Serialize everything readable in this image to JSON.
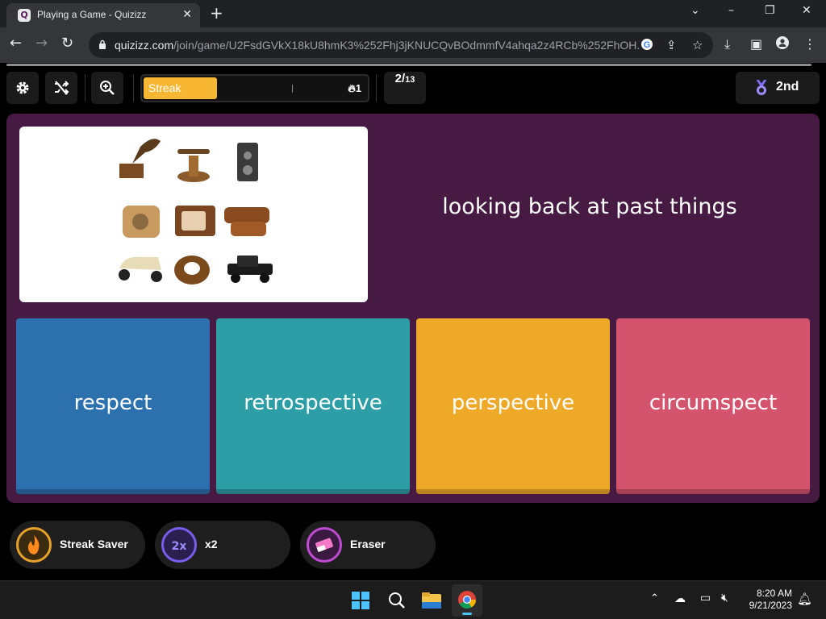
{
  "browser": {
    "tab_title": "Playing a Game - Quizizz",
    "url_host": "quizizz.com",
    "url_path": "/join/game/U2FsdGVkX18kU8hmK3%252Fhj3jKNUCQvBOdmmfV4ahqa2z4RCb%252FhOH...",
    "favicon_letter": "Q"
  },
  "game": {
    "streak_label": "Streak",
    "streak_count": "1",
    "streak_fill_fraction": 0.33,
    "question_current": "2",
    "question_total": "13",
    "rank": "2nd"
  },
  "question": {
    "text": "looking back at past things"
  },
  "options": [
    {
      "label": "respect",
      "color": "#2d70ae"
    },
    {
      "label": "retrospective",
      "color": "#2d9da6"
    },
    {
      "label": "perspective",
      "color": "#efa929"
    },
    {
      "label": "circumspect",
      "color": "#d5546d"
    }
  ],
  "powerups": [
    {
      "label": "Streak Saver",
      "icon": "streak-saver-icon"
    },
    {
      "label": "x2",
      "icon": "double-points-icon"
    },
    {
      "label": "Eraser",
      "icon": "eraser-icon"
    }
  ],
  "taskbar": {
    "time": "8:20 AM",
    "date": "9/21/2023"
  }
}
